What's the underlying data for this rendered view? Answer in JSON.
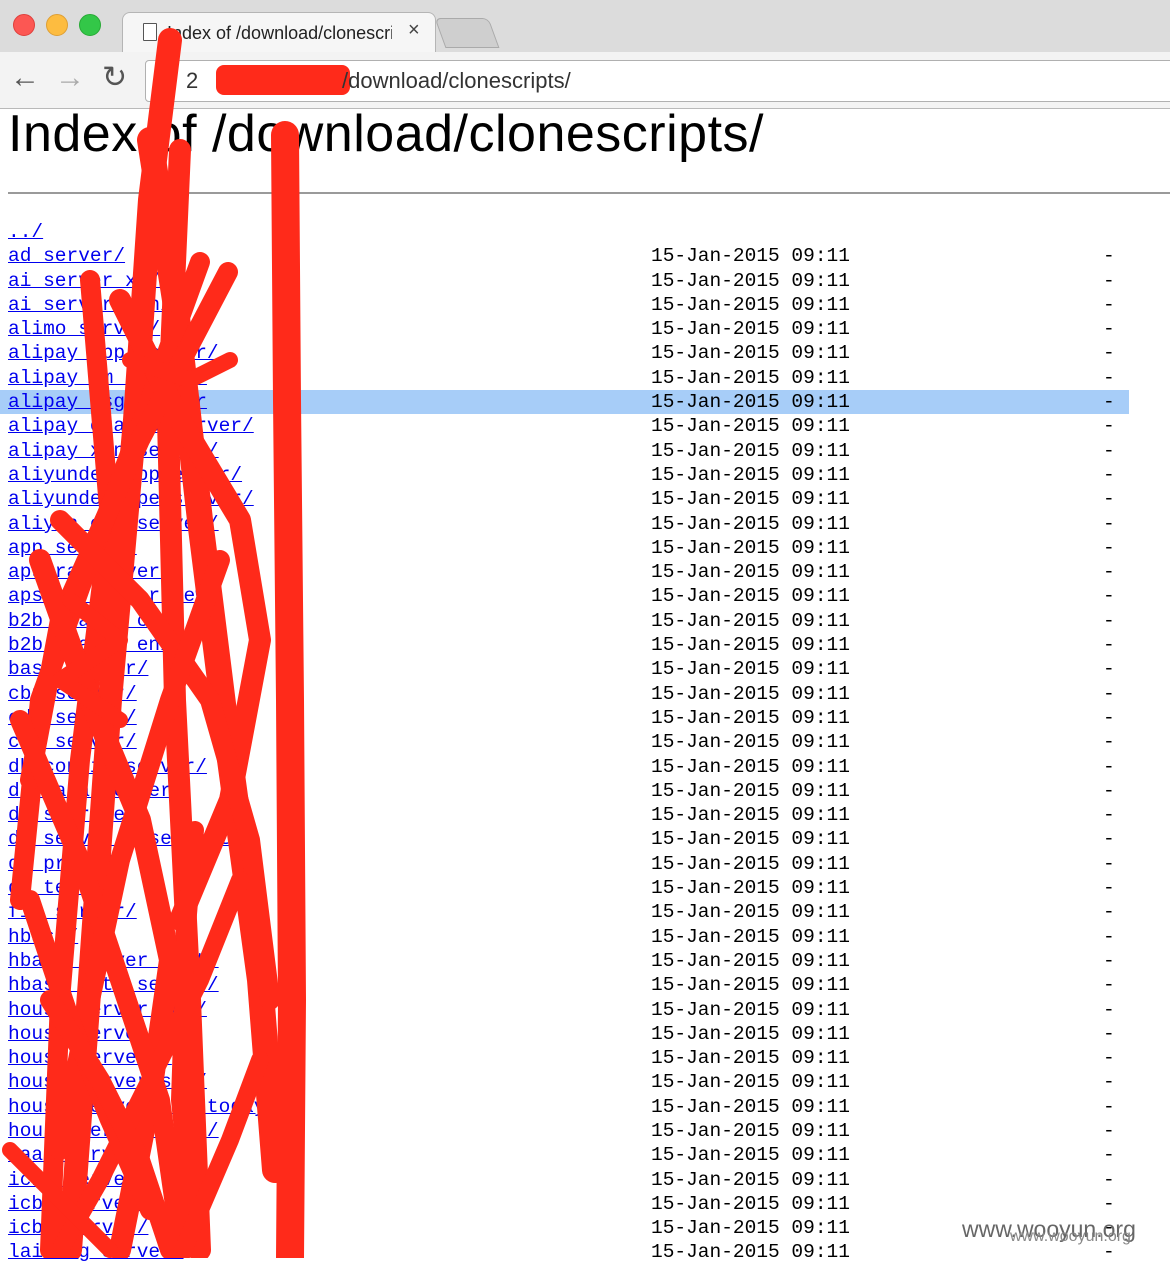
{
  "browser": {
    "tab_title": "Index of /download/clonescripts/",
    "tab_close": "×",
    "nav": {
      "back": "←",
      "forward": "→",
      "reload": "↻"
    },
    "url_prefix": "2",
    "url_path": "/download/clonescripts/"
  },
  "page": {
    "heading": "Index of /download/clonescripts/",
    "parent_link": "../",
    "entries": [
      {
        "name": "ad_server/",
        "date": "15-Jan-2015 09:11",
        "size": "-"
      },
      {
        "name": "ai_server_xc/",
        "date": "15-Jan-2015 09:11",
        "size": "-"
      },
      {
        "name": "ai_server_xen/",
        "date": "15-Jan-2015 09:11",
        "size": "-"
      },
      {
        "name": "alimo_server/",
        "date": "15-Jan-2015 09:11",
        "size": "-"
      },
      {
        "name": "alipay_app_server/",
        "date": "15-Jan-2015 09:11",
        "size": "-"
      },
      {
        "name": "alipay_km_server/",
        "date": "15-Jan-2015 09:11",
        "size": "-"
      },
      {
        "name": "alipay_msg_server",
        "date": "15-Jan-2015 09:11",
        "size": "-",
        "highlighted": true
      },
      {
        "name": "alipay_oracle_server/",
        "date": "15-Jan-2015 09:11",
        "size": "-"
      },
      {
        "name": "alipay_xen_server/",
        "date": "15-Jan-2015 09:11",
        "size": "-"
      },
      {
        "name": "aliyunder_appserver/",
        "date": "15-Jan-2015 09:11",
        "size": "-"
      },
      {
        "name": "aliyunder_openserver/",
        "date": "15-Jan-2015 09:11",
        "size": "-"
      },
      {
        "name": "aliyun_com_server/",
        "date": "15-Jan-2015 09:11",
        "size": "-"
      },
      {
        "name": "app_server/",
        "date": "15-Jan-2015 09:11",
        "size": "-"
      },
      {
        "name": "apsara_server/",
        "date": "15-Jan-2015 09:11",
        "size": "-"
      },
      {
        "name": "apsara_server_new/",
        "date": "15-Jan-2015 09:11",
        "size": "-"
      },
      {
        "name": "b2b_search_cn/",
        "date": "15-Jan-2015 09:11",
        "size": "-"
      },
      {
        "name": "b2b_search_en/",
        "date": "15-Jan-2015 09:11",
        "size": "-"
      },
      {
        "name": "base_server/",
        "date": "15-Jan-2015 09:11",
        "size": "-"
      },
      {
        "name": "cbu_server/",
        "date": "15-Jan-2015 09:11",
        "size": "-"
      },
      {
        "name": "cdn_server/",
        "date": "15-Jan-2015 09:11",
        "size": "-"
      },
      {
        "name": "cdo_server/",
        "date": "15-Jan-2015 09:11",
        "size": "-"
      },
      {
        "name": "db_config_server/",
        "date": "15-Jan-2015 09:11",
        "size": "-"
      },
      {
        "name": "db_data_server/",
        "date": "15-Jan-2015 09:11",
        "size": "-"
      },
      {
        "name": "db_storage/",
        "date": "15-Jan-2015 09:11",
        "size": "-"
      },
      {
        "name": "db_server_base_test/",
        "date": "15-Jan-2015 09:11",
        "size": "-"
      },
      {
        "name": "db_proxy/",
        "date": "15-Jan-2015 09:11",
        "size": "-"
      },
      {
        "name": "db_test/",
        "date": "15-Jan-2015 09:11",
        "size": "-"
      },
      {
        "name": "fin_server/",
        "date": "15-Jan-2015 09:11",
        "size": "-"
      },
      {
        "name": "hbase/",
        "date": "15-Jan-2015 09:11",
        "size": "-"
      },
      {
        "name": "hbase_server_test/",
        "date": "15-Jan-2015 09:11",
        "size": "-"
      },
      {
        "name": "hbase_data_server/",
        "date": "15-Jan-2015 09:11",
        "size": "-"
      },
      {
        "name": "house_server_new/",
        "date": "15-Jan-2015 09:11",
        "size": "-"
      },
      {
        "name": "house_server/",
        "date": "15-Jan-2015 09:11",
        "size": "-"
      },
      {
        "name": "house_server_/",
        "date": "15-Jan-2015 09:11",
        "size": "-"
      },
      {
        "name": "house_server_shi/",
        "date": "15-Jan-2015 09:11",
        "size": "-"
      },
      {
        "name": "house_server_shi_today/",
        "date": "15-Jan-2015 09:11",
        "size": "-"
      },
      {
        "name": "house_server_test/",
        "date": "15-Jan-2015 09:11",
        "size": "-"
      },
      {
        "name": "iaas_server/",
        "date": "15-Jan-2015 09:11",
        "size": "-"
      },
      {
        "name": "icbu_server/",
        "date": "15-Jan-2015 09:11",
        "size": "-"
      },
      {
        "name": "icbu_server/",
        "date": "15-Jan-2015 09:11",
        "size": "-"
      },
      {
        "name": "icbu_server/",
        "date": "15-Jan-2015 09:11",
        "size": "-"
      },
      {
        "name": "laiwang_server/",
        "date": "15-Jan-2015 09:11",
        "size": "-"
      }
    ]
  },
  "watermark": "www.wooyun.org",
  "watermark_small": "www.wooyun.org",
  "colors": {
    "link": "#0000ee",
    "highlight": "#a7cdf8",
    "redaction": "#ff2a1a",
    "traffic_close": "#fc5753",
    "traffic_min": "#fdbc40",
    "traffic_max": "#33c748"
  }
}
